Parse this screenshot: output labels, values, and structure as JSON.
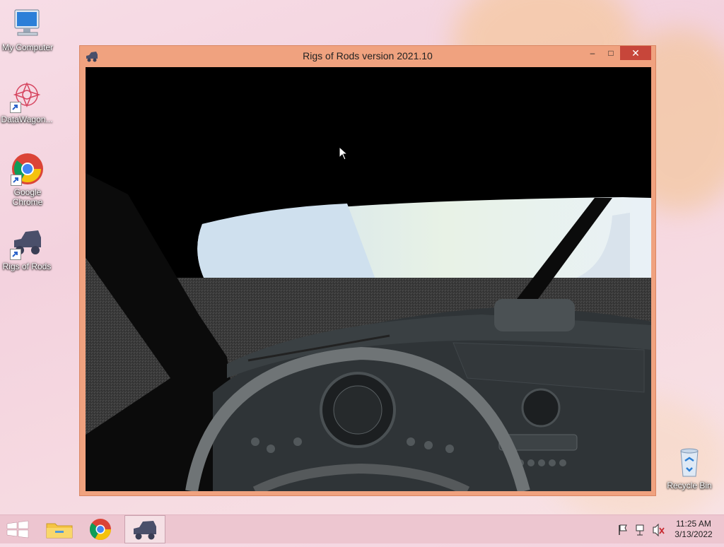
{
  "desktop": {
    "icons": [
      {
        "label": "My Computer"
      },
      {
        "label": "DataWagon..."
      },
      {
        "label": "Google Chrome"
      },
      {
        "label": "Rigs of Rods"
      },
      {
        "label": "Recycle Bin"
      }
    ]
  },
  "window": {
    "title": "Rigs of Rods version 2021.10",
    "minimize_label": "–",
    "maximize_label": "□",
    "close_label": "✕"
  },
  "taskbar": {
    "time": "11:25 AM",
    "date": "3/13/2022"
  },
  "colors": {
    "window_frame": "#f0a27f",
    "close_button": "#c7463a",
    "taskbar": "#ecc3ce"
  }
}
